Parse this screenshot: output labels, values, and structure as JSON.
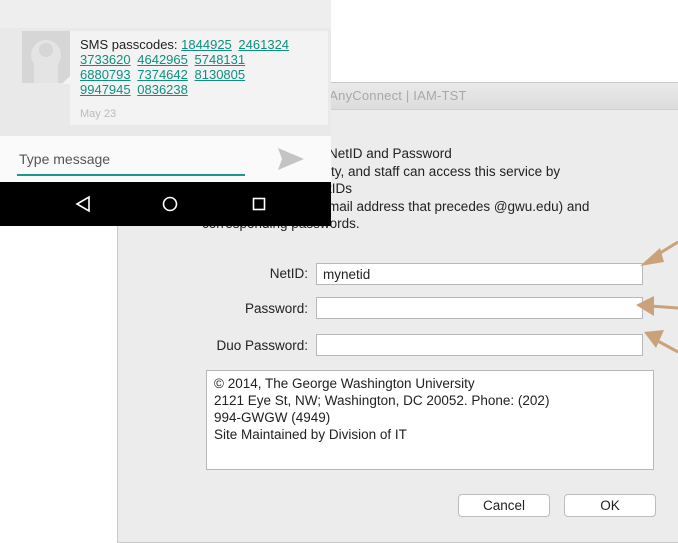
{
  "dialog": {
    "title": "AnyConnect | IAM-TST",
    "intro_lines": [
      "NetID and Password",
      "lty, and staff can access this service by",
      "tIDs",
      "mail address that precedes @gwu.edu) and",
      "corresponding passwords."
    ],
    "netid_label": "NetID:",
    "netid_value": "mynetid",
    "password_label": "Password:",
    "password_value": "",
    "duo_label": "Duo Password:",
    "duo_value": "",
    "info_lines": [
      "© 2014, The George Washington University",
      "2121 Eye St, NW; Washington, DC 20052. Phone: (202)",
      "994-GWGW (4949)",
      "Site Maintained by Division of IT"
    ],
    "cancel_label": "Cancel",
    "ok_label": "OK"
  },
  "phone": {
    "sms_prefix": "SMS passcodes:",
    "passcodes": [
      "1844925",
      "2461324",
      "3733620",
      "4642965",
      "5748131",
      "6880793",
      "7374642",
      "8130805",
      "9947945",
      "0836238"
    ],
    "date": "May 23",
    "composer_placeholder": "Type message"
  },
  "colors": {
    "link": "#0f8f7f",
    "arrow": "#c9a27c",
    "navbar": "#000000"
  },
  "icons": {
    "send": "send-icon",
    "back": "back-triangle-icon",
    "home": "home-circle-icon",
    "recents": "recents-square-icon"
  }
}
